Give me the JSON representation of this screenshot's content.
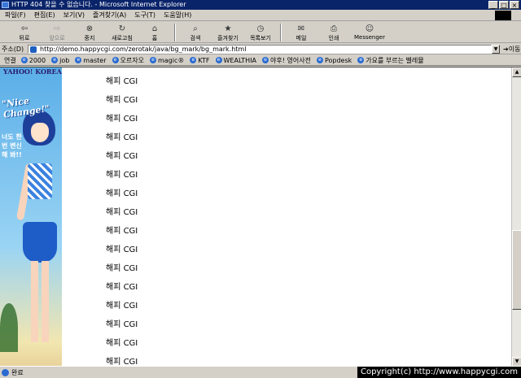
{
  "window": {
    "title": "HTTP 404 찾을 수 없습니다. - Microsoft Internet Explorer",
    "controls": [
      "_",
      "□",
      "×"
    ]
  },
  "menu": [
    "파일(F)",
    "편집(E)",
    "보기(V)",
    "즐겨찾기(A)",
    "도구(T)",
    "도움말(H)"
  ],
  "toolbar": {
    "back": "뒤로",
    "forward": "앞으로",
    "stop": "중지",
    "refresh": "새로고침",
    "home": "홈",
    "search": "검색",
    "favorites": "즐겨찾기",
    "history": "목록보기",
    "mail": "메일",
    "print": "인쇄",
    "messenger": "Messenger"
  },
  "address": {
    "label": "주소(D)",
    "url": "http://demo.happycgi.com/zerotak/java/bg_mark/bg_mark.html",
    "go": "이동"
  },
  "links": {
    "label": "연결",
    "items": [
      "2000",
      "job",
      "master",
      "오르자오",
      "magic®",
      "KTF",
      "WEALTHIA",
      "야후! 영어사전",
      "Popdesk",
      "가요를 부르는 벨레뮬"
    ]
  },
  "banner": {
    "logo": "YAHOO! KOREA",
    "slogan": "\"Nice Change!\"",
    "bubble": "너도 한 번 변신해 봐!!"
  },
  "content": {
    "rows": [
      "해피 CGI",
      "해피 CGI",
      "해피 CGI",
      "해피 CGI",
      "해피 CGI",
      "해피 CGI",
      "해피 CGI",
      "해피 CGI",
      "해피 CGI",
      "해피 CGI",
      "해피 CGI",
      "해피 CGI",
      "해피 CGI",
      "해피 CGI",
      "해피 CGI",
      "해피 CGI",
      "해피 CGI"
    ]
  },
  "status": {
    "text": "완료",
    "copyright": "Copyright(c) http://www.happycgi.com"
  }
}
